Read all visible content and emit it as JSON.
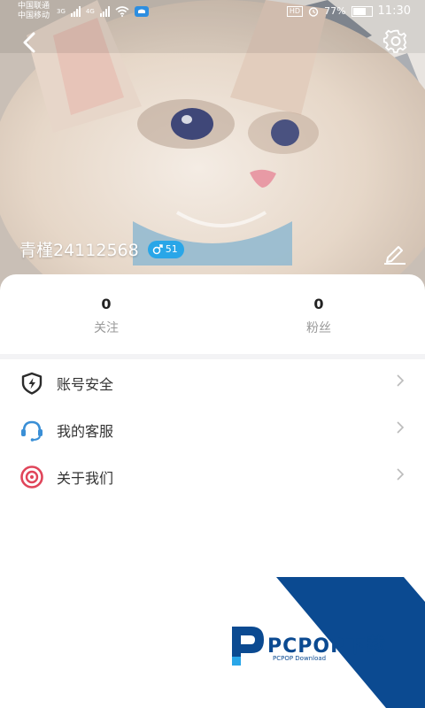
{
  "status_bar": {
    "carrier_1": "中国联通",
    "carrier_2": "中国移动",
    "network_1": "3G",
    "network_2": "4G",
    "hd": "HD",
    "battery": "77%",
    "time": "11:30"
  },
  "header": {
    "back_icon": "chevron-left-icon",
    "settings_icon": "gear-icon",
    "username": "青槿24112568",
    "gender": "male",
    "level": "51",
    "edit_icon": "pencil-icon"
  },
  "stats": {
    "following_count": "0",
    "following_label": "关注",
    "followers_count": "0",
    "followers_label": "粉丝"
  },
  "menu": {
    "items": [
      {
        "label": "账号安全",
        "icon": "shield-lightning-icon"
      },
      {
        "label": "我的客服",
        "icon": "headset-icon"
      },
      {
        "label": "关于我们",
        "icon": "target-icon"
      }
    ]
  },
  "watermark": {
    "brand": "PCPOP下载",
    "sub": "PCPOP Download",
    "color": "#0b4a91"
  },
  "colors": {
    "accent_blue": "#29a6e8",
    "security_icon": "#2b2b2b",
    "service_icon": "#3a8fd6",
    "about_icon": "#e0455a"
  }
}
